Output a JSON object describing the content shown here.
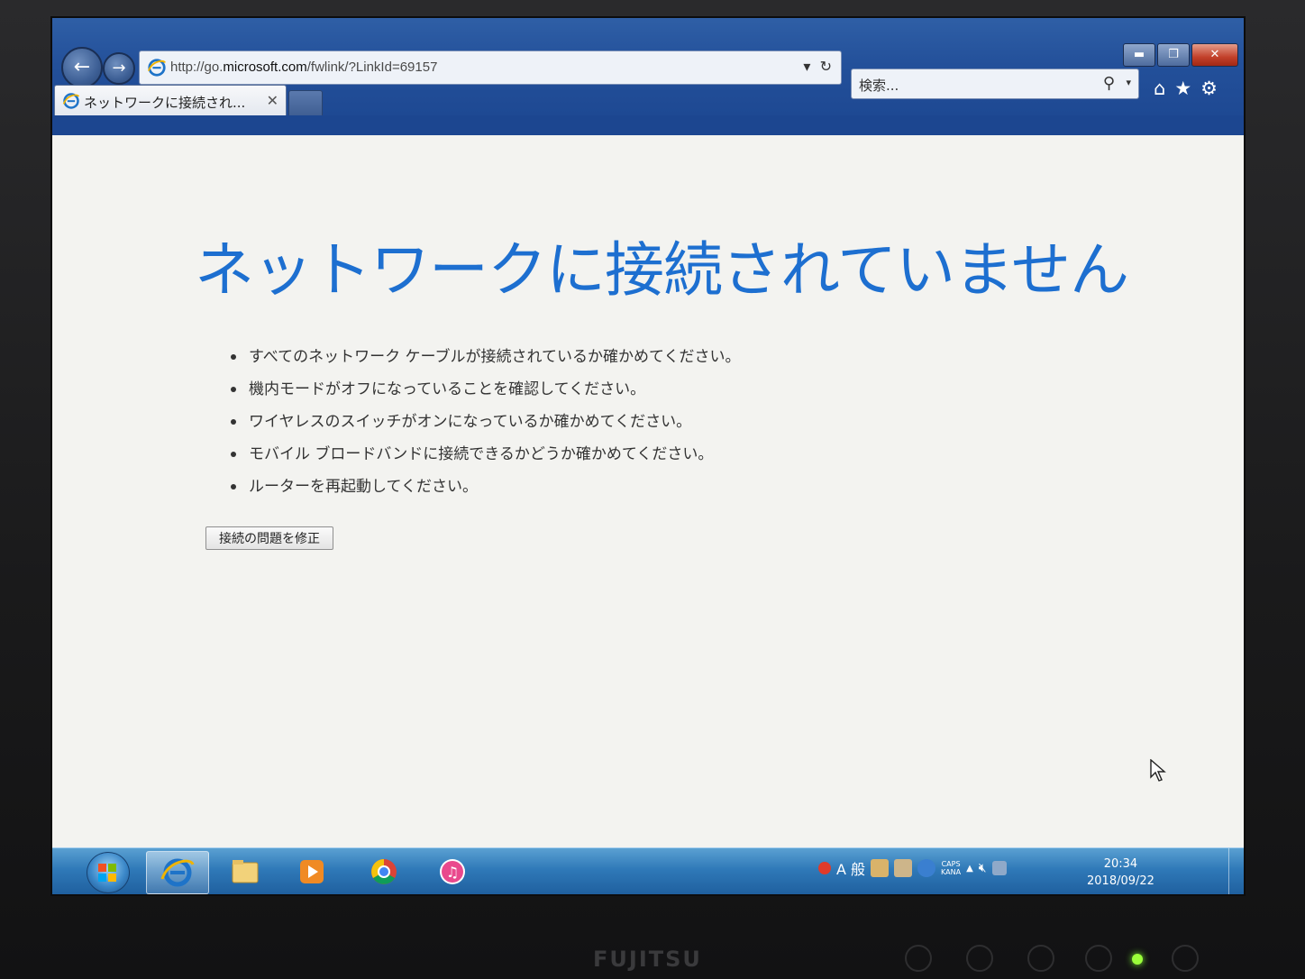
{
  "browser": {
    "address": {
      "url_prefix": "http://go.",
      "url_domain": "microsoft.com",
      "url_rest": "/fwlink/?LinkId=69157",
      "dropdown_glyph": "▾",
      "refresh_glyph": "↻"
    },
    "search": {
      "placeholder": "検索...",
      "icon": "search-icon",
      "dropdown_glyph": "▾"
    },
    "tab": {
      "label": "ネットワークに接続され...",
      "close_glyph": "✕"
    },
    "window_controls": {
      "minimize_glyph": "▬",
      "restore_glyph": "❐",
      "close_glyph": "✕"
    },
    "tools": {
      "home_glyph": "⌂",
      "favorites_glyph": "★",
      "settings_glyph": "⚙"
    },
    "nav": {
      "back_glyph": "←",
      "forward_glyph": "→"
    }
  },
  "page": {
    "title": "ネットワークに接続されていません",
    "tips": [
      "すべてのネットワーク ケーブルが接続されているか確かめてください。",
      "機内モードがオフになっていることを確認してください。",
      "ワイヤレスのスイッチがオンになっているか確かめてください。",
      "モバイル ブロードバンドに接続できるかどうか確かめてください。",
      "ルーターを再起動してください。"
    ],
    "fix_button": "接続の問題を修正"
  },
  "taskbar": {
    "ime_label": "A 般",
    "caps": "CAPS",
    "kana": "KANA",
    "tray_arrow": "▲",
    "time": "20:34",
    "date": "2018/09/22"
  },
  "monitor": {
    "brand": "FUJITSU"
  },
  "colors": {
    "title_blue": "#1d6fd0",
    "chrome_blue": "#23509a",
    "taskbar_blue": "#2f79b8"
  }
}
